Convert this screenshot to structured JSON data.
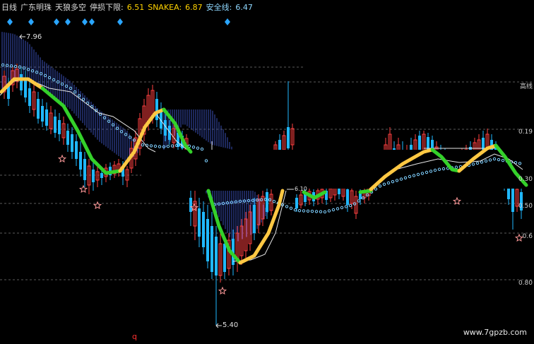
{
  "header": {
    "period": "日线",
    "stock_name": "广东明珠",
    "indicator": "天狼多空",
    "stop_loss_label": "停损下限:",
    "stop_loss_value": "6.51",
    "snakea_label": "SNAKEA:",
    "snakea_value": "6.87",
    "safety_label": "安全线:",
    "safety_value": "6.47"
  },
  "right_axis": {
    "labels": [
      "高线",
      "0.19",
      "0.30",
      "0.50",
      "0.6",
      "0.80"
    ]
  },
  "markers": {
    "high_price": "7.96",
    "low_price": "5.40",
    "mid_price": "6.10",
    "bottom_letter": "q"
  },
  "watermark": "www.7gpzb.com",
  "colors": {
    "background": "#000000",
    "rise": "#ff4040",
    "fall": "#20b8ff",
    "bull_line": "#ffc843",
    "bear_line": "#34d12a",
    "snake_dots": "#7fd0ff",
    "safety_line": "#e6e6e6",
    "dashed_grid": "#5a5a5a",
    "diamond": "#2aa6ff",
    "star": "#ff9a9a"
  }
}
